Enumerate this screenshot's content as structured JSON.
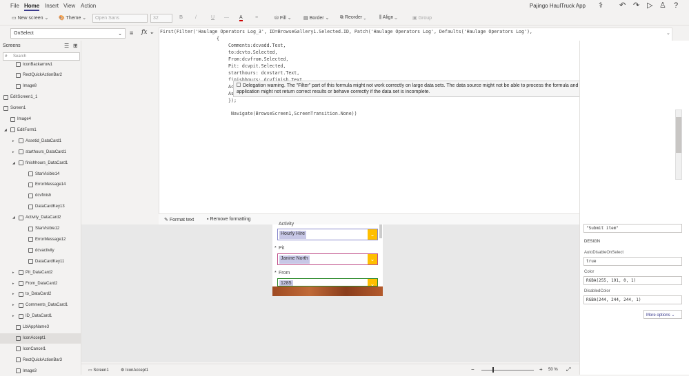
{
  "menu": {
    "file": "File",
    "home": "Home",
    "insert": "Insert",
    "view": "View",
    "action": "Action"
  },
  "app_title": "Pajingo HaulTruck App",
  "ribbon": {
    "new_screen": "New screen",
    "theme": "Theme",
    "font": "Open Sans",
    "font_size": "32",
    "bold": "B",
    "fill": "Fill",
    "border": "Border",
    "reorder": "Reorder",
    "align": "Align",
    "group": "Group"
  },
  "formula_bar": {
    "property": "OnSelect",
    "equals": "=",
    "fx": "fx"
  },
  "tree": {
    "header": "Screens",
    "search_placeholder": "Search",
    "items": [
      {
        "label": "IconBackarrow1",
        "type": "icon"
      },
      {
        "label": "RectQuickActionBar2",
        "type": "rect"
      },
      {
        "label": "Image8",
        "type": "image"
      },
      {
        "label": "EditScreen1_1",
        "type": "screen"
      },
      {
        "label": "Screen1",
        "type": "screen"
      },
      {
        "label": "Image4",
        "type": "image"
      },
      {
        "label": "EditForm1",
        "type": "form"
      },
      {
        "label": "Assetid_DataCard1",
        "type": "card"
      },
      {
        "label": "starthours_DataCard1",
        "type": "card"
      },
      {
        "label": "finishhours_DataCard1",
        "type": "card"
      },
      {
        "label": "StarVisible14",
        "type": "label"
      },
      {
        "label": "ErrorMessage14",
        "type": "label"
      },
      {
        "label": "dcvfinish",
        "type": "input"
      },
      {
        "label": "DataCardKey13",
        "type": "label"
      },
      {
        "label": "Activity_DataCard2",
        "type": "card"
      },
      {
        "label": "StarVisible12",
        "type": "label"
      },
      {
        "label": "ErrorMessage12",
        "type": "label"
      },
      {
        "label": "dcvactivity",
        "type": "input"
      },
      {
        "label": "DataCardKey11",
        "type": "label"
      },
      {
        "label": "Pit_DataCard2",
        "type": "card"
      },
      {
        "label": "From_DataCard2",
        "type": "card"
      },
      {
        "label": "to_DataCard2",
        "type": "card"
      },
      {
        "label": "Comments_DataCard1",
        "type": "card"
      },
      {
        "label": "ID_DataCard1",
        "type": "card"
      },
      {
        "label": "LblAppName3",
        "type": "label"
      },
      {
        "label": "IconAccept1",
        "type": "icon"
      },
      {
        "label": "IconCancel1",
        "type": "icon"
      },
      {
        "label": "RectQuickActionBar3",
        "type": "rect"
      },
      {
        "label": "Image3",
        "type": "image"
      }
    ]
  },
  "code": {
    "line1": "First(Filter('Haulage Operators Log_3', ID=BrowseGallery1.Selected.ID, Patch('Haulage Operators Log', Defaults('Haulage Operators Log'),",
    "line2": "{",
    "line3": "Comments:dcvadd.Text,",
    "line4": "to:dcvto.Selected,",
    "line5": "From:dcvfrom.Selected,",
    "line6": "Pit: dcvpit.Selected,",
    "line7": "starthours: dcvstart.Text,",
    "line8": "finishhours: dcvfinish.Text",
    "line9a": "Ac",
    "line9b": "As",
    "line10": "});",
    "line11": "Navigate(BrowseScreen1,ScreenTransition.None))"
  },
  "warning": "Delegation warning. The \"Filter\" part of this formula might not work correctly on large data sets. The data source might not be able to process the formula and might return an incomplete data set. Your application might not return correct results or behave correctly if the data set is incomplete.",
  "editor_footer": {
    "format_text": "Format text",
    "remove_formatting": "Remove formatting"
  },
  "form": {
    "activity_label": "Activity",
    "activity_value": "Hourly Hire",
    "pit_label": "Pit",
    "pit_value": "Janine North",
    "from_label": "From",
    "from_value": "1285",
    "required_mark": "*"
  },
  "right_panel": {
    "text_value": "\"Submit item\"",
    "design_header": "DESIGN",
    "auto_disable_label": "AutoDisableOnSelect",
    "auto_disable_value": "true",
    "color_label": "Color",
    "color_value": "RGBA(255, 191, 0, 1)",
    "disabled_color_label": "DisabledColor",
    "disabled_color_value": "RGBA(244, 244, 244, 1)",
    "more_options": "More options"
  },
  "status": {
    "screen_tab": "Screen1",
    "control_tab": "IconAccept1",
    "zoom": "50 %",
    "minus": "−",
    "plus": "+"
  },
  "colors": {
    "accent": "#ffbf00",
    "brand": "#3a3a8c",
    "selection": "#c7c7e6"
  }
}
